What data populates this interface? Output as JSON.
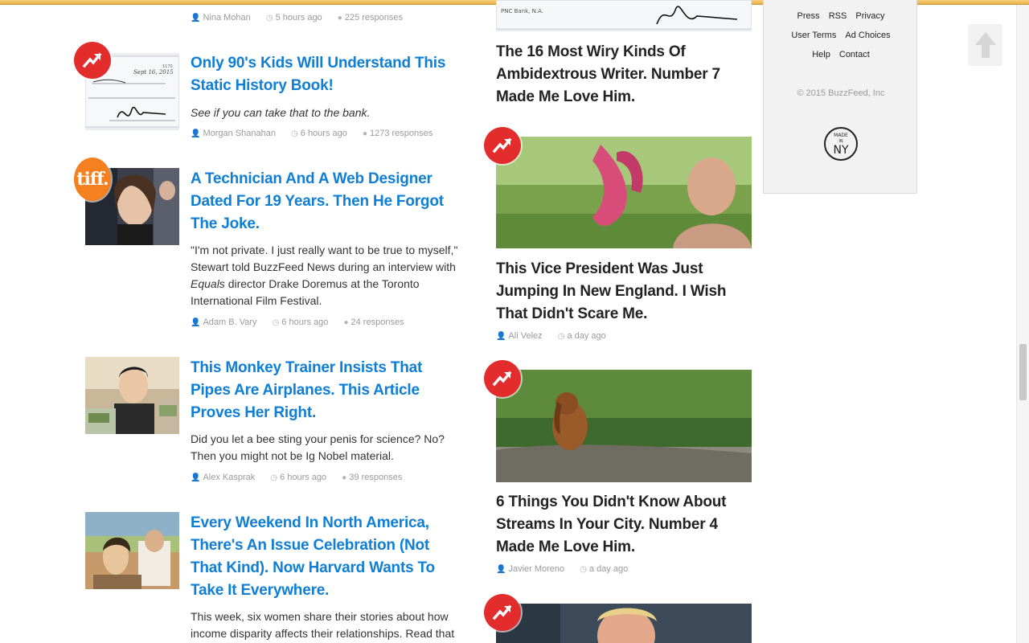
{
  "brand": {
    "accent": "#0f7ed6",
    "trending_red": "#e32d2d",
    "tiff_orange": "#f4801f"
  },
  "feed": [
    {
      "author": "Nina Mohan",
      "time": "5 hours ago",
      "responses": "225 responses"
    },
    {
      "badge": "trending-icon",
      "title": "Only 90's Kids Will Understand This Static History Book!",
      "desc": "See if you can take that to the bank.",
      "author": "Morgan Shanahan",
      "time": "6 hours ago",
      "responses": "1273 responses"
    },
    {
      "badge": "tiff",
      "badge_text": "tiff.",
      "title": "A Technician And A Web Designer Dated For 19 Years. Then He Forgot The Joke.",
      "desc_before": "\"I'm not private. I just really want to be true to myself,\" Stewart told BuzzFeed News during an interview with ",
      "desc_em": "Equals",
      "desc_after": " director Drake Doremus at the Toronto International Film Festival.",
      "author": "Adam B. Vary",
      "time": "6 hours ago",
      "responses": "24 responses"
    },
    {
      "title": "This Monkey Trainer Insists That Pipes Are Airplanes. This Article Proves Her Right.",
      "desc": "Did you let a bee sting your penis for science? No? Then you might not be Ig Nobel material.",
      "author": "Alex Kasprak",
      "time": "6 hours ago",
      "responses": "39 responses"
    },
    {
      "title": "Every Weekend In North America, There's An Issue Celebration (Not That Kind). Now Harvard Wants To Take It Everywhere.",
      "desc": "This week, six women share their stories about how income disparity affects their relationships. Read that"
    }
  ],
  "middle": [
    {
      "title": "The 16 Most Wiry Kinds Of Ambidextrous Writer. Number 7 Made Me Love Him.",
      "cheque_bank": "PNC Bank, N.A."
    },
    {
      "badge": "trending-icon",
      "title": "This Vice President Was Just Jumping In New England. I Wish That Didn't Scare Me.",
      "author": "Ali Velez",
      "time": "a day ago"
    },
    {
      "badge": "trending-icon",
      "title": "6 Things You Didn't Know About Streams In Your City. Number 4 Made Me Love Him.",
      "author": "Javier Moreno",
      "time": "a day ago"
    },
    {
      "badge": "trending-icon"
    }
  ],
  "sidebar": {
    "row1": [
      "Press",
      "RSS",
      "Privacy"
    ],
    "row2": [
      "User Terms",
      "Ad Choices"
    ],
    "row3": [
      "Help",
      "Contact"
    ],
    "copyright": "© 2015 BuzzFeed, Inc",
    "made_in_ny": {
      "top": "MADE",
      "mid": "IN",
      "bottom": "NY"
    }
  },
  "scroll_top": {
    "icon": "arrow-up-icon"
  },
  "cheque": {
    "date": "Sept 16, 2015",
    "number": "1170"
  }
}
